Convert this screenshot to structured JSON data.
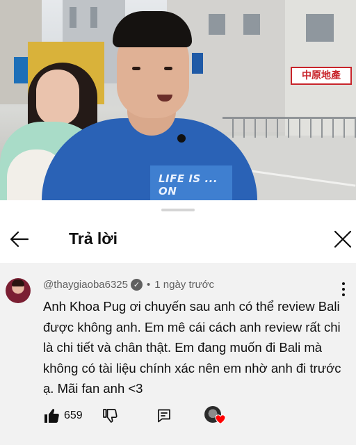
{
  "video": {
    "shop_sign_text": "中原地產",
    "shirt_text": "LIFE IS ... ON"
  },
  "header": {
    "title": "Trả lời",
    "back_icon": "arrow-left-icon",
    "close_icon": "close-icon"
  },
  "comment": {
    "author": "@thaygiaoba6325",
    "separator": "•",
    "time": "1 ngày trước",
    "text": "Anh Khoa Pug ơi chuyến sau anh có thể review Bali được không anh. Em mê cái cách anh review rất chi là chi tiết và chân thật. Em đang muốn đi Bali mà không có tài liệu chính xác nên em nhờ anh đi trước ạ. Mãi fan anh <3",
    "like_count": "659",
    "icons": {
      "like": "thumbs-up-filled-icon",
      "dislike": "thumbs-down-icon",
      "reply": "reply-comment-icon",
      "creator_heart": "creator-heart-icon",
      "more": "more-vertical-icon",
      "verified": "verified-check-icon"
    },
    "colors": {
      "heart": "#ff0000",
      "background": "#f2f2f2",
      "secondary_text": "#606060"
    }
  }
}
